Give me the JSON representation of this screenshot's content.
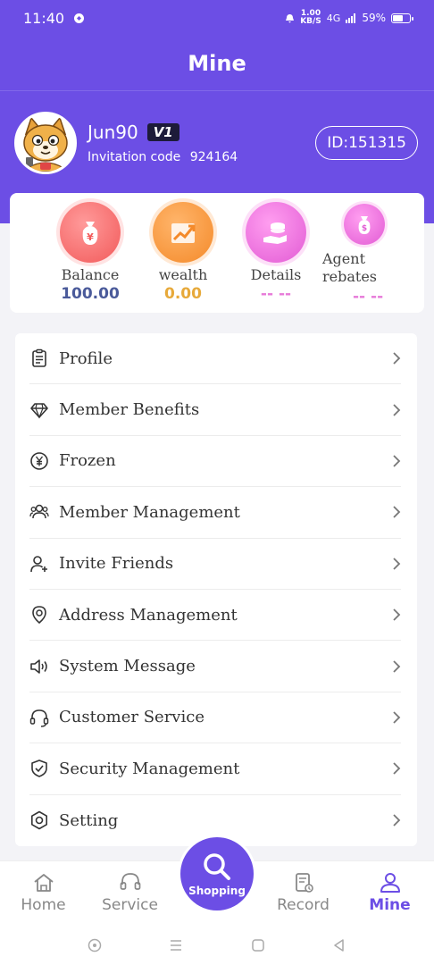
{
  "status_bar": {
    "time": "11:40",
    "net_speed_top": "1.00",
    "net_speed_bottom": "KB/S",
    "signal": "4G",
    "battery": "59%"
  },
  "header": {
    "title": "Mine"
  },
  "profile": {
    "username": "Jun90",
    "vip_level": "V1",
    "invitation_label": "Invitation code",
    "invitation_code": "924164",
    "id_label": "ID:151315"
  },
  "stats": [
    {
      "label": "Balance",
      "value": "100.00"
    },
    {
      "label": "wealth",
      "value": "0.00"
    },
    {
      "label": "Details",
      "value": "-- --"
    },
    {
      "label": "Agent rebates",
      "value": "-- --"
    }
  ],
  "menu": [
    {
      "label": "Profile",
      "icon": "clipboard-icon"
    },
    {
      "label": "Member Benefits",
      "icon": "diamond-icon"
    },
    {
      "label": "Frozen",
      "icon": "yen-circle-icon"
    },
    {
      "label": "Member Management",
      "icon": "users-icon"
    },
    {
      "label": "Invite Friends",
      "icon": "user-plus-icon"
    },
    {
      "label": "Address Management",
      "icon": "location-pin-icon"
    },
    {
      "label": "System Message",
      "icon": "speaker-icon"
    },
    {
      "label": "Customer Service",
      "icon": "headset-icon"
    },
    {
      "label": "Security Management",
      "icon": "shield-check-icon"
    },
    {
      "label": "Setting",
      "icon": "gear-icon"
    }
  ],
  "tabbar": {
    "home": "Home",
    "service": "Service",
    "shopping": "Shopping",
    "record": "Record",
    "mine": "Mine",
    "active": "Mine"
  },
  "colors": {
    "accent": "#6c4ee5",
    "balance_value": "#4a5a9a",
    "wealth_value": "#e7a93a",
    "details_value": "#e77ad9"
  }
}
